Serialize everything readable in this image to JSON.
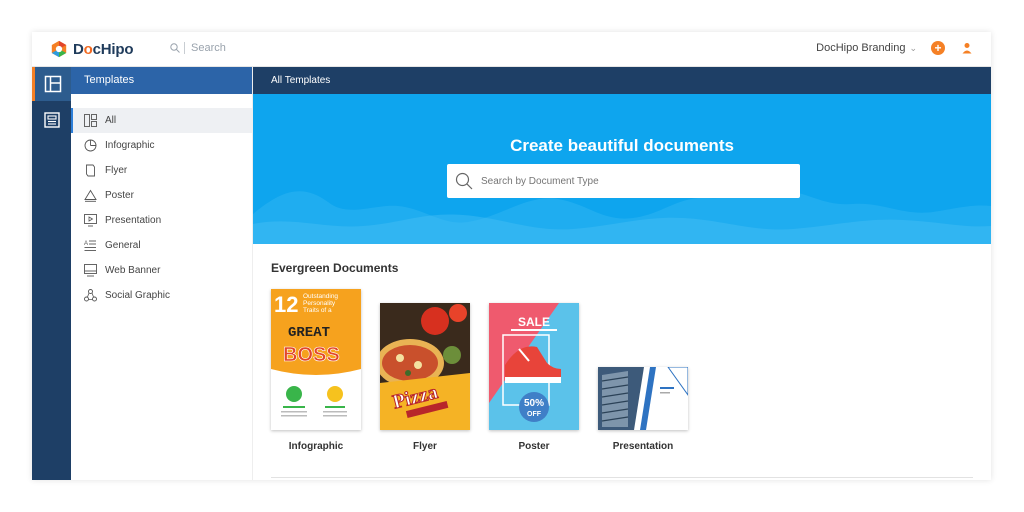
{
  "app": {
    "logo_prefix": "D",
    "logo_o": "o",
    "logo_suffix": "cHipo",
    "search_placeholder": "Search",
    "account_label": "DocHipo Branding",
    "plus_label": "+"
  },
  "rail": {
    "items": [
      "templates-icon",
      "document-icon"
    ]
  },
  "sidebar": {
    "header": "Templates",
    "items": [
      {
        "label": "All",
        "icon": "grid-icon",
        "active": true
      },
      {
        "label": "Infographic",
        "icon": "pie-icon"
      },
      {
        "label": "Flyer",
        "icon": "flyer-icon"
      },
      {
        "label": "Poster",
        "icon": "triangle-icon"
      },
      {
        "label": "Presentation",
        "icon": "presentation-icon"
      },
      {
        "label": "General",
        "icon": "text-lines-icon"
      },
      {
        "label": "Web Banner",
        "icon": "monitor-icon"
      },
      {
        "label": "Social Graphic",
        "icon": "social-icon"
      }
    ]
  },
  "main": {
    "header": "All Templates",
    "hero_title": "Create beautiful documents",
    "hero_search_placeholder": "Search by Document Type",
    "section_title": "Evergreen Documents",
    "cards": [
      {
        "label": "Infographic"
      },
      {
        "label": "Flyer"
      },
      {
        "label": "Poster"
      },
      {
        "label": "Presentation"
      }
    ],
    "infographic_thumb": {
      "num": "12",
      "line1": "Outstanding",
      "line2": "Personality",
      "line3": "Traits of a",
      "great": "GREAT",
      "boss": "BOSS"
    },
    "flyer_thumb": {
      "word": "Pizza"
    },
    "poster_thumb": {
      "sale": "SALE",
      "pct": "50%",
      "off": "OFF"
    }
  },
  "colors": {
    "brand_navy": "#1e3f66",
    "brand_blue": "#2c64a8",
    "hero_blue": "#0ea5ee",
    "accent_orange": "#f58025"
  }
}
